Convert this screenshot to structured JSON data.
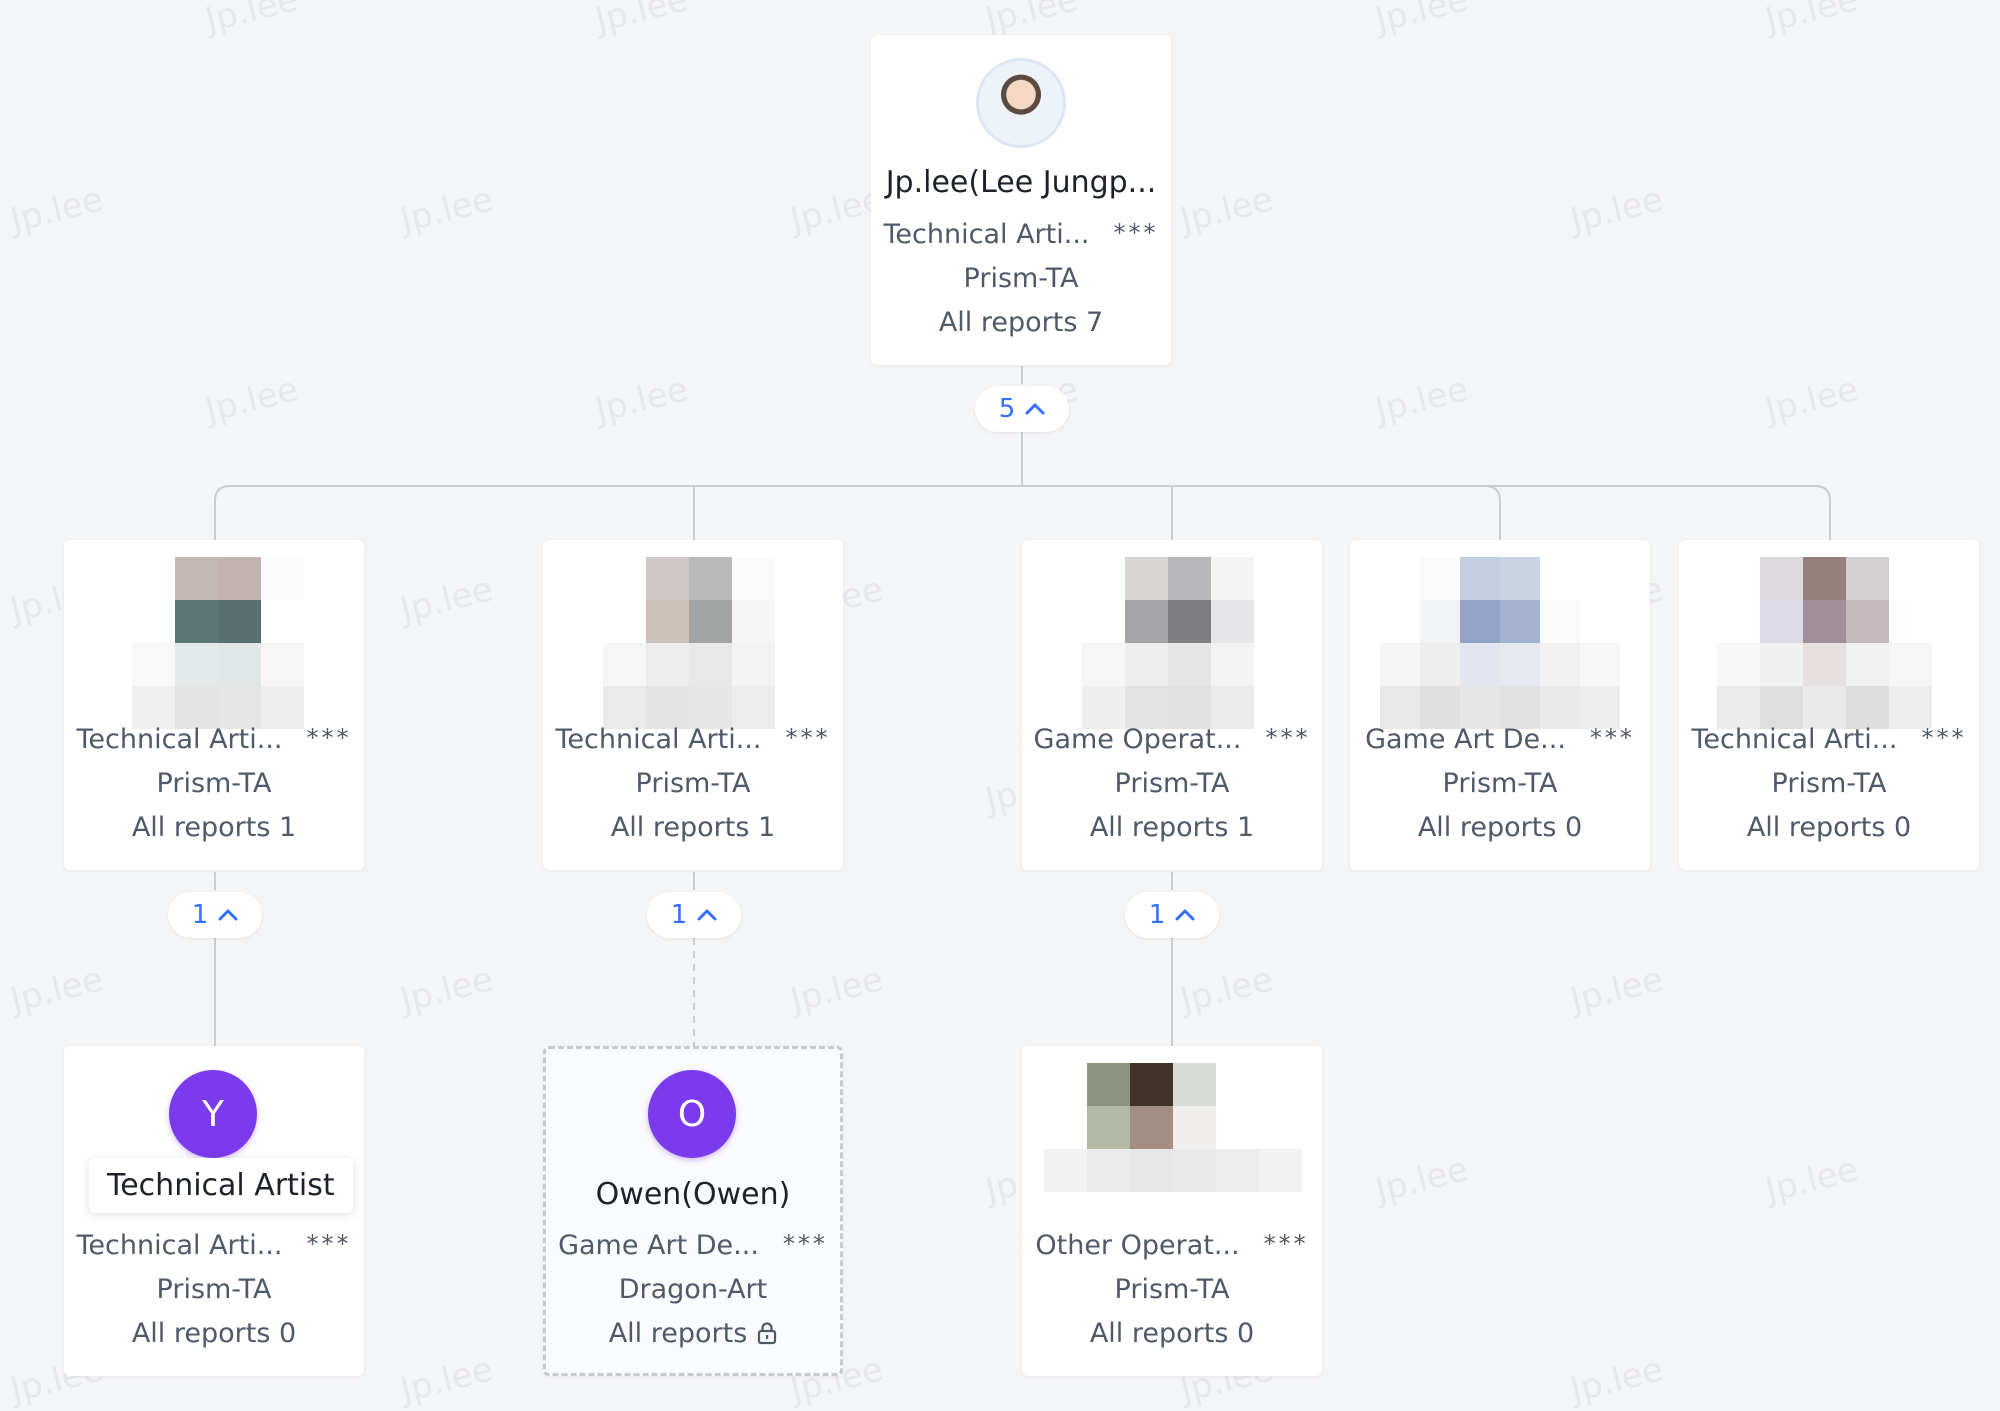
{
  "watermark": "Jp.lee",
  "root": {
    "name": "Jp.lee(Lee Jungp...",
    "title": "Technical Arti...",
    "masked": "***",
    "team": "Prism-TA",
    "reports": "All reports 7",
    "toggle_count": "5"
  },
  "level1": [
    {
      "title": "Technical Arti...",
      "masked": "***",
      "team": "Prism-TA",
      "reports": "All reports 1",
      "toggle_count": "1"
    },
    {
      "title": "Technical Arti...",
      "masked": "***",
      "team": "Prism-TA",
      "reports": "All reports 1",
      "toggle_count": "1"
    },
    {
      "title": "Game Operat...",
      "masked": "***",
      "team": "Prism-TA",
      "reports": "All reports 1",
      "toggle_count": "1"
    },
    {
      "title": "Game Art De...",
      "masked": "***",
      "team": "Prism-TA",
      "reports": "All reports 0"
    },
    {
      "title": "Technical Arti...",
      "masked": "***",
      "team": "Prism-TA",
      "reports": "All reports 0"
    }
  ],
  "level2": [
    {
      "avatar_letter": "Y",
      "tooltip": "Technical Artist",
      "title": "Technical Arti...",
      "masked": "***",
      "team": "Prism-TA",
      "reports": "All reports 0"
    },
    {
      "avatar_letter": "O",
      "name": "Owen(Owen)",
      "title": "Game Art De...",
      "masked": "***",
      "team": "Dragon-Art",
      "reports": "All reports"
    },
    {
      "title": "Other Operat...",
      "masked": "***",
      "team": "Prism-TA",
      "reports": "All reports 0"
    }
  ],
  "colors": {
    "accent": "#3370ff",
    "avatar": "#7c3aed",
    "background": "#f4f5f7"
  }
}
